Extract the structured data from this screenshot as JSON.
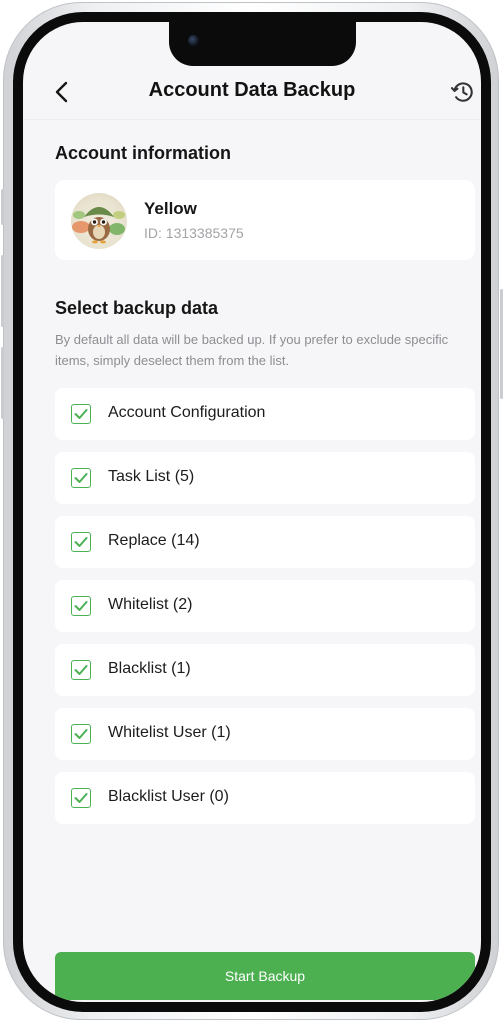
{
  "header": {
    "title": "Account Data Backup",
    "back_icon": "chevron-left-icon",
    "history_icon": "history-icon"
  },
  "account": {
    "section_title": "Account information",
    "name": "Yellow",
    "id_text": "ID: 1313385375"
  },
  "backup": {
    "section_title": "Select backup data",
    "hint": "By default all data will be backed up. If you prefer to exclude specific items, simply deselect them from the list.",
    "items": [
      {
        "label": "Account Configuration",
        "checked": true
      },
      {
        "label": "Task List (5)",
        "checked": true
      },
      {
        "label": "Replace (14)",
        "checked": true
      },
      {
        "label": "Whitelist (2)",
        "checked": true
      },
      {
        "label": "Blacklist (1)",
        "checked": true
      },
      {
        "label": "Whitelist User (1)",
        "checked": true
      },
      {
        "label": "Blacklist User (0)",
        "checked": true
      }
    ]
  },
  "actions": {
    "start_label": "Start Backup"
  },
  "colors": {
    "accent": "#4caf50",
    "background": "#f6f6f8"
  }
}
